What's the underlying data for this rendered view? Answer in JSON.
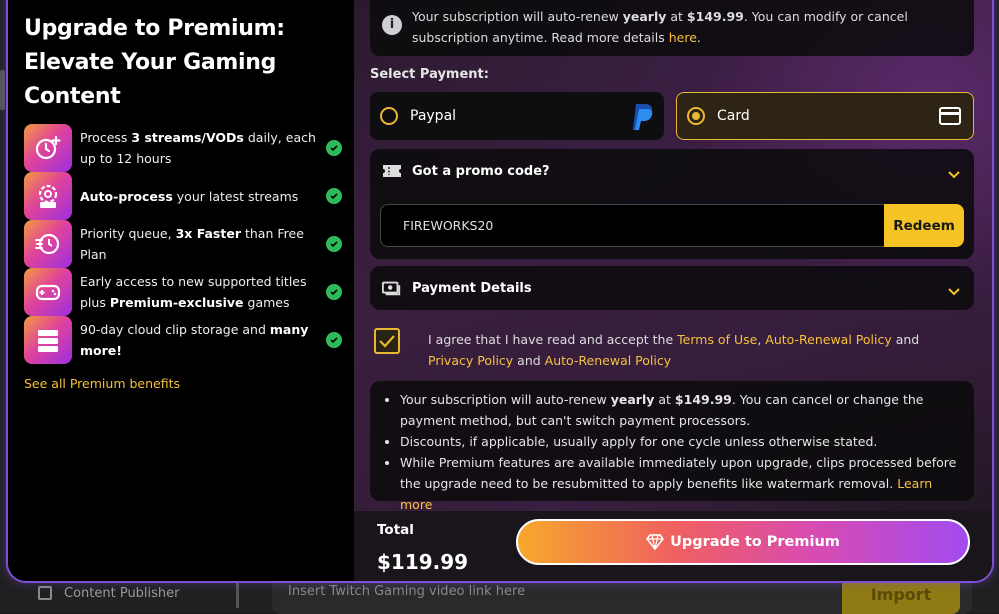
{
  "background": {
    "sidebar_item": "Content Publisher",
    "input_placeholder": "Insert Twitch Gaming video link here",
    "import_label": "Import"
  },
  "left": {
    "title": "Upgrade to Premium: Elevate Your Gaming Content",
    "features": [
      {
        "icon": "clock-plus-icon",
        "pre": "Process ",
        "bold": "3 streams/VODs",
        "post": " daily, each up to 12 hours"
      },
      {
        "icon": "auto-gear-icon",
        "pre": "",
        "bold": "Auto-process",
        "post": " your latest streams"
      },
      {
        "icon": "fast-clock-icon",
        "pre": "Priority queue, ",
        "bold": "3x Faster",
        "post": " than Free Plan"
      },
      {
        "icon": "gamepad-icon",
        "pre": "Early access to new supported titles plus ",
        "bold": "Premium-exclusive",
        "post": " games"
      },
      {
        "icon": "storage-icon",
        "pre": "90-day cloud clip storage and ",
        "bold": "many more!",
        "post": ""
      }
    ],
    "see_all": "See all Premium benefits"
  },
  "right": {
    "info": {
      "pre": "Your subscription will auto-renew ",
      "bold": "yearly",
      "mid": " at ",
      "price": "$149.99",
      "post": ". You can modify or cancel subscription anytime. Read more details ",
      "link": "here",
      "end": "."
    },
    "select_payment_label": "Select Payment:",
    "payment_options": [
      {
        "label": "Paypal",
        "selected": false,
        "icon": "paypal-icon"
      },
      {
        "label": "Card",
        "selected": true,
        "icon": "credit-card-icon"
      }
    ],
    "promo": {
      "title": "Got a promo code?",
      "value": "FIREWORKS20",
      "redeem_label": "Redeem"
    },
    "payment_details_title": "Payment Details",
    "agree": {
      "checked": true,
      "pre": "I agree that I have read and accept the ",
      "link1": "Terms of Use",
      "sep1": ", ",
      "link2": "Auto-Renewal Policy",
      "and1": " and ",
      "link3": "Privacy Policy",
      "and2": " and ",
      "link4": "Auto-Renewal Policy"
    },
    "notes": {
      "n1_pre": "Your subscription will auto-renew ",
      "n1_bold1": "yearly",
      "n1_mid": " at ",
      "n1_bold2": "$149.99",
      "n1_post": ". You can cancel or change the payment method, but can't switch payment processors.",
      "n2": "Discounts, if applicable, usually apply for one cycle unless otherwise stated.",
      "n3": "While Premium features are available immediately upon upgrade, clips processed before the upgrade need to be resubmitted to apply benefits like watermark removal. ",
      "n3_link": "Learn more"
    },
    "total_label": "Total",
    "total_value": "$119.99",
    "upgrade_label": "Upgrade to Premium"
  },
  "colors": {
    "accent_yellow": "#f5c324",
    "check_green": "#2dbb5a",
    "border_purple": "#7f4fd8"
  }
}
